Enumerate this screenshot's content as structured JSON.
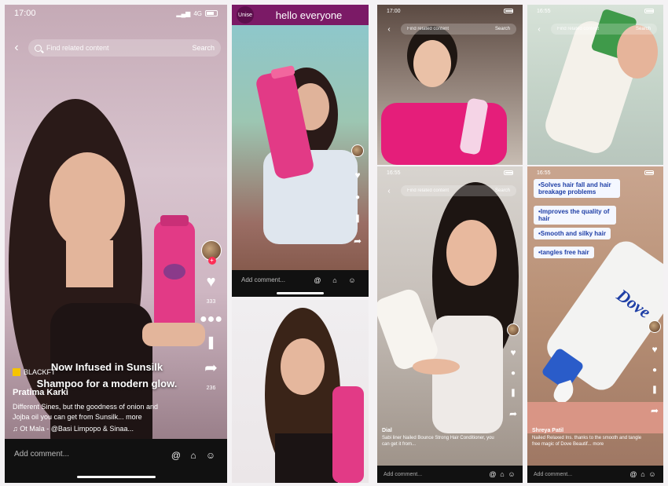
{
  "panels": {
    "p1": {
      "status": {
        "time": "17:00",
        "network": "4G"
      },
      "search": {
        "placeholder": "Find related content",
        "button": "Search"
      },
      "overlay_text": "Now Infused in Sunsilk Shampoo for a modern glow.",
      "badge": "BLACKFT",
      "username": "Pratima Karki",
      "caption": "Different Sines, but the goodness of onion and Jojba oil you can get from Sunsilk... more",
      "music": "♫ Ot Mala - @Basi Limpopo & Sinaa...",
      "likes": "333",
      "shares": "236",
      "comment_placeholder": "Add comment..."
    },
    "p2": {
      "header": "hello everyone",
      "channel_label": "Unise",
      "comment_placeholder": "Add comment..."
    },
    "p3": {
      "status": {
        "time": "17:00"
      },
      "search": {
        "placeholder": "Find related content",
        "button": "Search"
      }
    },
    "p4": {
      "status": {
        "time": "16:55"
      },
      "search": {
        "placeholder": "Find related content",
        "button": "Search"
      },
      "username": "Dial",
      "caption": "Sabi liner Nailed Bounce Strong Hair Conditioner, you can get it from...",
      "comment_placeholder": "Add comment..."
    },
    "p5": {
      "status": {
        "time": "16:55"
      },
      "search": {
        "placeholder": "Find related content",
        "button": "Search"
      }
    },
    "p6": {
      "status": {
        "time": "16:55"
      },
      "bullets": [
        "•Solves hair fall and hair breakage problems",
        "•Improves the quality of hair",
        "•Smooth and silky hair",
        "•tangles free hair"
      ],
      "brand": "Dove",
      "username": "Shreya Patil",
      "caption": "Nailed Relaxed Ins. thanks to the smooth and tangle free magic of Dove Beautif... more",
      "comment_placeholder": "Add comment..."
    }
  },
  "colors": {
    "pink_bottle": "#e23a86",
    "header_purple": "#7b1a66",
    "tiktok_red": "#fe2c55"
  }
}
